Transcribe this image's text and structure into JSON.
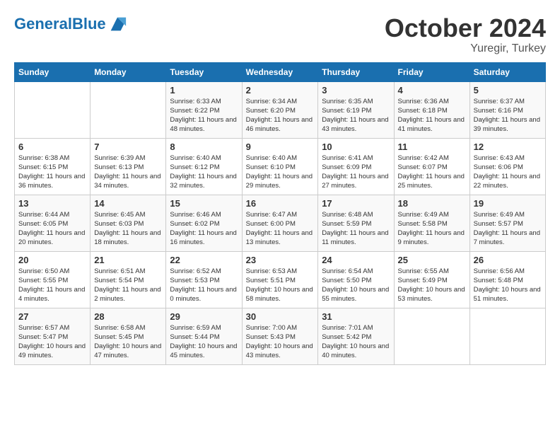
{
  "logo": {
    "line1": "General",
    "line2": "Blue"
  },
  "title": "October 2024",
  "subtitle": "Yuregir, Turkey",
  "headers": [
    "Sunday",
    "Monday",
    "Tuesday",
    "Wednesday",
    "Thursday",
    "Friday",
    "Saturday"
  ],
  "weeks": [
    [
      {
        "day": "",
        "info": ""
      },
      {
        "day": "",
        "info": ""
      },
      {
        "day": "1",
        "info": "Sunrise: 6:33 AM\nSunset: 6:22 PM\nDaylight: 11 hours and 48 minutes."
      },
      {
        "day": "2",
        "info": "Sunrise: 6:34 AM\nSunset: 6:20 PM\nDaylight: 11 hours and 46 minutes."
      },
      {
        "day": "3",
        "info": "Sunrise: 6:35 AM\nSunset: 6:19 PM\nDaylight: 11 hours and 43 minutes."
      },
      {
        "day": "4",
        "info": "Sunrise: 6:36 AM\nSunset: 6:18 PM\nDaylight: 11 hours and 41 minutes."
      },
      {
        "day": "5",
        "info": "Sunrise: 6:37 AM\nSunset: 6:16 PM\nDaylight: 11 hours and 39 minutes."
      }
    ],
    [
      {
        "day": "6",
        "info": "Sunrise: 6:38 AM\nSunset: 6:15 PM\nDaylight: 11 hours and 36 minutes."
      },
      {
        "day": "7",
        "info": "Sunrise: 6:39 AM\nSunset: 6:13 PM\nDaylight: 11 hours and 34 minutes."
      },
      {
        "day": "8",
        "info": "Sunrise: 6:40 AM\nSunset: 6:12 PM\nDaylight: 11 hours and 32 minutes."
      },
      {
        "day": "9",
        "info": "Sunrise: 6:40 AM\nSunset: 6:10 PM\nDaylight: 11 hours and 29 minutes."
      },
      {
        "day": "10",
        "info": "Sunrise: 6:41 AM\nSunset: 6:09 PM\nDaylight: 11 hours and 27 minutes."
      },
      {
        "day": "11",
        "info": "Sunrise: 6:42 AM\nSunset: 6:07 PM\nDaylight: 11 hours and 25 minutes."
      },
      {
        "day": "12",
        "info": "Sunrise: 6:43 AM\nSunset: 6:06 PM\nDaylight: 11 hours and 22 minutes."
      }
    ],
    [
      {
        "day": "13",
        "info": "Sunrise: 6:44 AM\nSunset: 6:05 PM\nDaylight: 11 hours and 20 minutes."
      },
      {
        "day": "14",
        "info": "Sunrise: 6:45 AM\nSunset: 6:03 PM\nDaylight: 11 hours and 18 minutes."
      },
      {
        "day": "15",
        "info": "Sunrise: 6:46 AM\nSunset: 6:02 PM\nDaylight: 11 hours and 16 minutes."
      },
      {
        "day": "16",
        "info": "Sunrise: 6:47 AM\nSunset: 6:00 PM\nDaylight: 11 hours and 13 minutes."
      },
      {
        "day": "17",
        "info": "Sunrise: 6:48 AM\nSunset: 5:59 PM\nDaylight: 11 hours and 11 minutes."
      },
      {
        "day": "18",
        "info": "Sunrise: 6:49 AM\nSunset: 5:58 PM\nDaylight: 11 hours and 9 minutes."
      },
      {
        "day": "19",
        "info": "Sunrise: 6:49 AM\nSunset: 5:57 PM\nDaylight: 11 hours and 7 minutes."
      }
    ],
    [
      {
        "day": "20",
        "info": "Sunrise: 6:50 AM\nSunset: 5:55 PM\nDaylight: 11 hours and 4 minutes."
      },
      {
        "day": "21",
        "info": "Sunrise: 6:51 AM\nSunset: 5:54 PM\nDaylight: 11 hours and 2 minutes."
      },
      {
        "day": "22",
        "info": "Sunrise: 6:52 AM\nSunset: 5:53 PM\nDaylight: 11 hours and 0 minutes."
      },
      {
        "day": "23",
        "info": "Sunrise: 6:53 AM\nSunset: 5:51 PM\nDaylight: 10 hours and 58 minutes."
      },
      {
        "day": "24",
        "info": "Sunrise: 6:54 AM\nSunset: 5:50 PM\nDaylight: 10 hours and 55 minutes."
      },
      {
        "day": "25",
        "info": "Sunrise: 6:55 AM\nSunset: 5:49 PM\nDaylight: 10 hours and 53 minutes."
      },
      {
        "day": "26",
        "info": "Sunrise: 6:56 AM\nSunset: 5:48 PM\nDaylight: 10 hours and 51 minutes."
      }
    ],
    [
      {
        "day": "27",
        "info": "Sunrise: 6:57 AM\nSunset: 5:47 PM\nDaylight: 10 hours and 49 minutes."
      },
      {
        "day": "28",
        "info": "Sunrise: 6:58 AM\nSunset: 5:45 PM\nDaylight: 10 hours and 47 minutes."
      },
      {
        "day": "29",
        "info": "Sunrise: 6:59 AM\nSunset: 5:44 PM\nDaylight: 10 hours and 45 minutes."
      },
      {
        "day": "30",
        "info": "Sunrise: 7:00 AM\nSunset: 5:43 PM\nDaylight: 10 hours and 43 minutes."
      },
      {
        "day": "31",
        "info": "Sunrise: 7:01 AM\nSunset: 5:42 PM\nDaylight: 10 hours and 40 minutes."
      },
      {
        "day": "",
        "info": ""
      },
      {
        "day": "",
        "info": ""
      }
    ]
  ]
}
